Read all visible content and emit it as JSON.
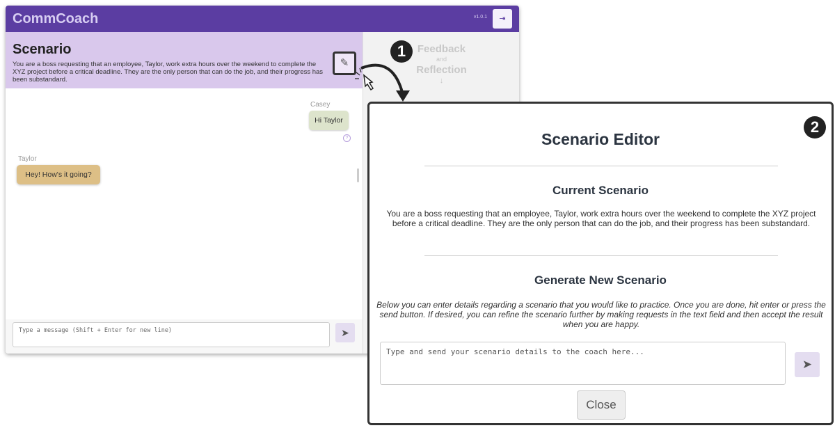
{
  "app": {
    "title": "CommCoach",
    "version": "v1.0.1",
    "logout_icon": "logout-icon"
  },
  "scenario": {
    "heading": "Scenario",
    "text": "You are a boss requesting that an employee, Taylor, work extra hours over the weekend to complete the XYZ project before a critical deadline. They are the only person that can do the job, and their progress has been substandard.",
    "edit_icon": "pencil-icon"
  },
  "feedback": {
    "line1": "Feedback",
    "line2": "and",
    "line3": "Reflection",
    "arrow": "↓"
  },
  "chat": {
    "messages": [
      {
        "sender": "Casey",
        "text": "Hi Taylor"
      },
      {
        "sender": "Taylor",
        "text": "Hey! How's it going?"
      }
    ],
    "input_placeholder": "Type a message (Shift + Enter for new line)"
  },
  "annotations": {
    "badge1": "1",
    "badge2": "2"
  },
  "editor": {
    "title": "Scenario Editor",
    "current_heading": "Current Scenario",
    "current_text": "You are a boss requesting that an employee, Taylor, work extra hours over the weekend to complete the XYZ project before a critical deadline. They are the only person that can do the job, and their progress has been substandard.",
    "generate_heading": "Generate New Scenario",
    "instructions": "Below you can enter details regarding a scenario that you would like to practice. Once you are done, hit enter or press the send button. If desired, you can refine the scenario further by making requests in the text field and then accept the result when you are happy.",
    "input_placeholder": "Type and send your scenario details to the coach here...",
    "close_label": "Close"
  },
  "colors": {
    "brand": "#5b3da2",
    "scenario_bg": "#d9c8ec",
    "casey_bubble": "#dde4cc",
    "taylor_bubble": "#ddbf86"
  }
}
